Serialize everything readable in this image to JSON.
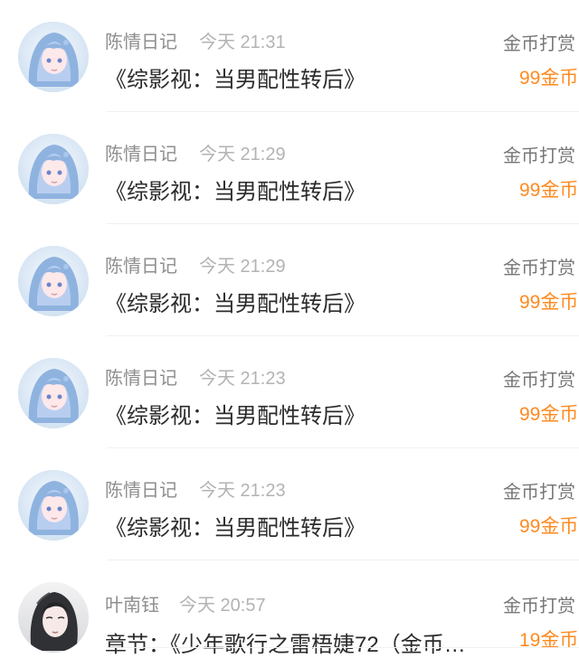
{
  "list": {
    "items": [
      {
        "name": "陈情日记",
        "time": "今天 21:31",
        "message": "《综影视：当男配性转后》",
        "reward_type": "金币打赏",
        "amount": "99金币",
        "avatar": "anime-girl-blue-hair-avatar"
      },
      {
        "name": "陈情日记",
        "time": "今天 21:29",
        "message": "《综影视：当男配性转后》",
        "reward_type": "金币打赏",
        "amount": "99金币",
        "avatar": "anime-girl-blue-hair-avatar"
      },
      {
        "name": "陈情日记",
        "time": "今天 21:29",
        "message": "《综影视：当男配性转后》",
        "reward_type": "金币打赏",
        "amount": "99金币",
        "avatar": "anime-girl-blue-hair-avatar"
      },
      {
        "name": "陈情日记",
        "time": "今天 21:23",
        "message": "《综影视：当男配性转后》",
        "reward_type": "金币打赏",
        "amount": "99金币",
        "avatar": "anime-girl-blue-hair-avatar"
      },
      {
        "name": "陈情日记",
        "time": "今天 21:23",
        "message": "《综影视：当男配性转后》",
        "reward_type": "金币打赏",
        "amount": "99金币",
        "avatar": "anime-girl-blue-hair-avatar"
      },
      {
        "name": "叶南钰",
        "time": "今天 20:57",
        "message": "章节：《少年歌行之雷梧婕72（金币…",
        "reward_type": "金币打赏",
        "amount": "19金币",
        "avatar": "dark-hair-anime-avatar"
      }
    ]
  },
  "colors": {
    "amount": "#ff8a1f",
    "name": "#8e8e8e",
    "time": "#b3b3b3",
    "message": "#2b2b2b"
  }
}
